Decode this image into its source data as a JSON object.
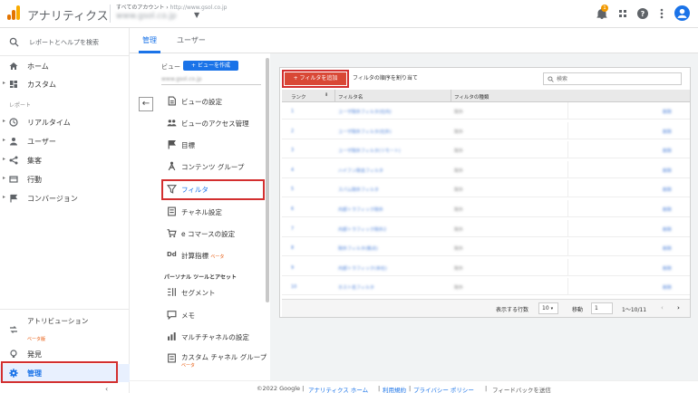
{
  "app": {
    "title": "アナリティクス",
    "account_line": "すべてのアカウント",
    "account_url": "http://www.gsol.co.jp",
    "property_name": "www.gsol.co.jp",
    "logo_colors": [
      "#f9ab00",
      "#e37400",
      "#e37400"
    ],
    "notification_count": "1"
  },
  "sidebar": {
    "search_label": "レポートとヘルプを検索",
    "items": [
      {
        "label": "ホーム",
        "icon": "home-icon"
      },
      {
        "label": "カスタム",
        "icon": "dashboard-icon"
      }
    ],
    "reports_section": "レポート",
    "report_items": [
      {
        "label": "リアルタイム",
        "icon": "clock-icon"
      },
      {
        "label": "ユーザー",
        "icon": "person-icon"
      },
      {
        "label": "集客",
        "icon": "acquisition-icon"
      },
      {
        "label": "行動",
        "icon": "behavior-icon"
      },
      {
        "label": "コンバージョン",
        "icon": "flag-icon"
      }
    ],
    "attribution_label": "アトリビューション",
    "attribution_beta": "ベータ版",
    "discover_label": "発見",
    "admin_label": "管理"
  },
  "tabs": {
    "admin": "管理",
    "users": "ユーザー"
  },
  "view": {
    "label": "ビュー",
    "create_button": "+ ビューを作成",
    "name": "www.gsol.co.jp"
  },
  "view_menu": {
    "items": [
      {
        "label": "ビューの設定",
        "icon": "document-icon"
      },
      {
        "label": "ビューのアクセス管理",
        "icon": "people-icon"
      },
      {
        "label": "目標",
        "icon": "flag-icon"
      },
      {
        "label": "コンテンツ グループ",
        "icon": "content-group-icon"
      },
      {
        "label": "フィルタ",
        "icon": "filter-icon"
      },
      {
        "label": "チャネル設定",
        "icon": "channel-icon"
      },
      {
        "label": "e コマースの設定",
        "icon": "cart-icon"
      },
      {
        "label": "計算指標",
        "icon": "calc-icon",
        "beta": "ベータ"
      }
    ],
    "personal_section": "パーソナル ツールとアセット",
    "personal_items": [
      {
        "label": "セグメント",
        "icon": "segment-icon"
      },
      {
        "label": "メモ",
        "icon": "memo-icon"
      },
      {
        "label": "マルチチャネルの設定",
        "icon": "multichannel-icon"
      },
      {
        "label": "カスタム チャネル グループ",
        "icon": "custom-channel-icon",
        "beta": "ベータ"
      }
    ]
  },
  "filters": {
    "add_button": "+ フィルタを追加",
    "reorder_button": "フィルタの順序を割り当て",
    "search_placeholder": "検索",
    "columns": [
      "ランク",
      "フィルタ名",
      "フィルタの種類"
    ],
    "rows": [
      {
        "rank": "1",
        "name": "ユーザ除外フィルタ(社内)",
        "type": "除外",
        "action": "削除"
      },
      {
        "rank": "2",
        "name": "ユーザ除外フィルタ(社外)",
        "type": "除外",
        "action": "削除"
      },
      {
        "rank": "3",
        "name": "ユーザ除外フィルタ(リモート)",
        "type": "除外",
        "action": "削除"
      },
      {
        "rank": "4",
        "name": "ハイフン除去フィルタ",
        "type": "除外",
        "action": "削除"
      },
      {
        "rank": "5",
        "name": "スパム除外フィルタ",
        "type": "除外",
        "action": "削除"
      },
      {
        "rank": "6",
        "name": "内部トラフィック除外",
        "type": "除外",
        "action": "削除"
      },
      {
        "rank": "7",
        "name": "内部トラフィック除外2",
        "type": "除外",
        "action": "削除"
      },
      {
        "rank": "8",
        "name": "除外フィルタ(拠点)",
        "type": "除外",
        "action": "削除"
      },
      {
        "rank": "9",
        "name": "内部トラフィック(本社)",
        "type": "除外",
        "action": "削除"
      },
      {
        "rank": "10",
        "name": "ホスト名フィルタ",
        "type": "除外",
        "action": "削除"
      }
    ],
    "pager": {
      "rows_label": "表示する行数",
      "rows_value": "10",
      "jump_label": "移動",
      "jump_value": "1",
      "range": "1〜10/11"
    }
  },
  "footer": {
    "copyright": "©2022 Google",
    "links": [
      "アナリティクス ホーム",
      "利用規約",
      "プライバシー ポリシー"
    ],
    "feedback": "フィードバックを送信"
  }
}
